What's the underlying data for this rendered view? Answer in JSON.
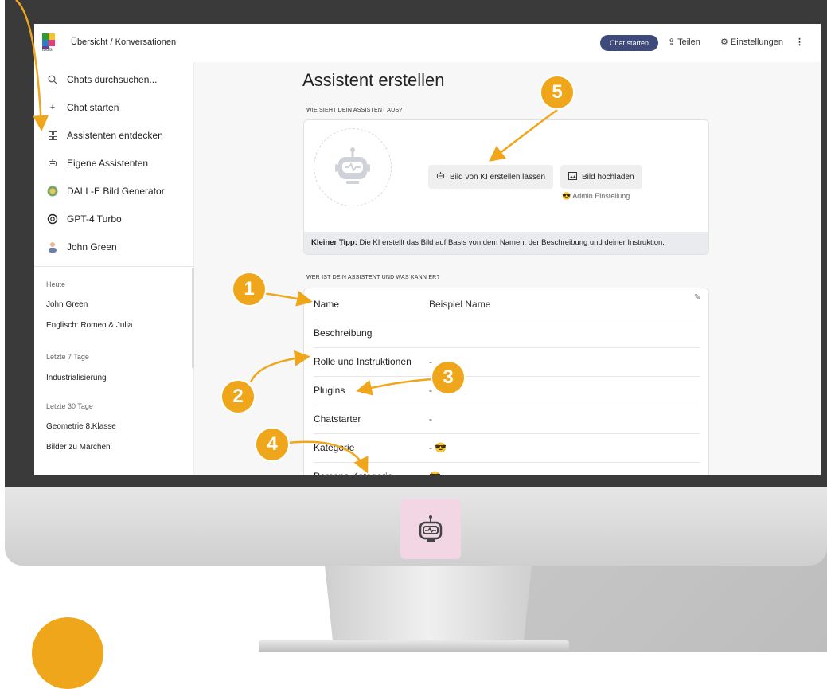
{
  "header": {
    "logo_text": "tools",
    "breadcrumb": "Übersicht / Konversationen",
    "chat_button": "Chat starten",
    "share": "Teilen",
    "settings": "Einstellungen",
    "more": "⋮"
  },
  "sidebar": {
    "items": [
      {
        "label": "Chats durchsuchen...",
        "icon": "search-icon"
      },
      {
        "label": "Chat starten",
        "icon": "plus-icon"
      },
      {
        "label": "Assistenten entdecken",
        "icon": "grid-icon"
      },
      {
        "label": "Eigene Assistenten",
        "icon": "robot-icon"
      },
      {
        "label": "DALL-E Bild Generator",
        "icon": "dalle-icon"
      },
      {
        "label": "GPT-4 Turbo",
        "icon": "openai-icon"
      },
      {
        "label": "John Green",
        "icon": "person-icon"
      }
    ],
    "history": {
      "today_label": "Heute",
      "today": [
        "John Green",
        "Englisch: Romeo & Julia"
      ],
      "week_label": "Letzte 7 Tage",
      "week": [
        "Industrialisierung"
      ],
      "month_label": "Letzte 30 Tage",
      "month": [
        "Geometrie 8.Klasse",
        "Bilder zu Märchen"
      ]
    }
  },
  "main": {
    "title": "Assistent erstellen",
    "section1_label": "WIE SIEHT DEIN ASSISTENT AUS?",
    "btn_ai_image": "Bild von KI erstellen lassen",
    "btn_upload": "Bild hochladen",
    "admin_setting": "Admin Einstellung",
    "tip_bold": "Kleiner Tipp:",
    "tip_text": " Die KI erstellt das Bild auf Basis von dem Namen, der Beschreibung und deiner Instruktion.",
    "section2_label": "WER IST DEIN ASSISTENT UND WAS KANN ER?",
    "rows": [
      {
        "key": "Name",
        "value": "Beispiel Name"
      },
      {
        "key": "Beschreibung",
        "value": ""
      },
      {
        "key": "Rolle und Instruktionen",
        "value": "-"
      },
      {
        "key": "Plugins",
        "value": "-"
      },
      {
        "key": "Chatstarter",
        "value": "-"
      },
      {
        "key": "Kategorie",
        "value": "- 😎"
      },
      {
        "key": "Persona Kategorie",
        "value": "😎"
      }
    ]
  },
  "annotations": {
    "badges": [
      "1",
      "2",
      "3",
      "4",
      "5"
    ],
    "color": "#f0a61a"
  },
  "colors": {
    "accent_button": "#3d4a7a",
    "badge": "#f0a61a",
    "chin_logo_bg": "#f2d6e4"
  }
}
